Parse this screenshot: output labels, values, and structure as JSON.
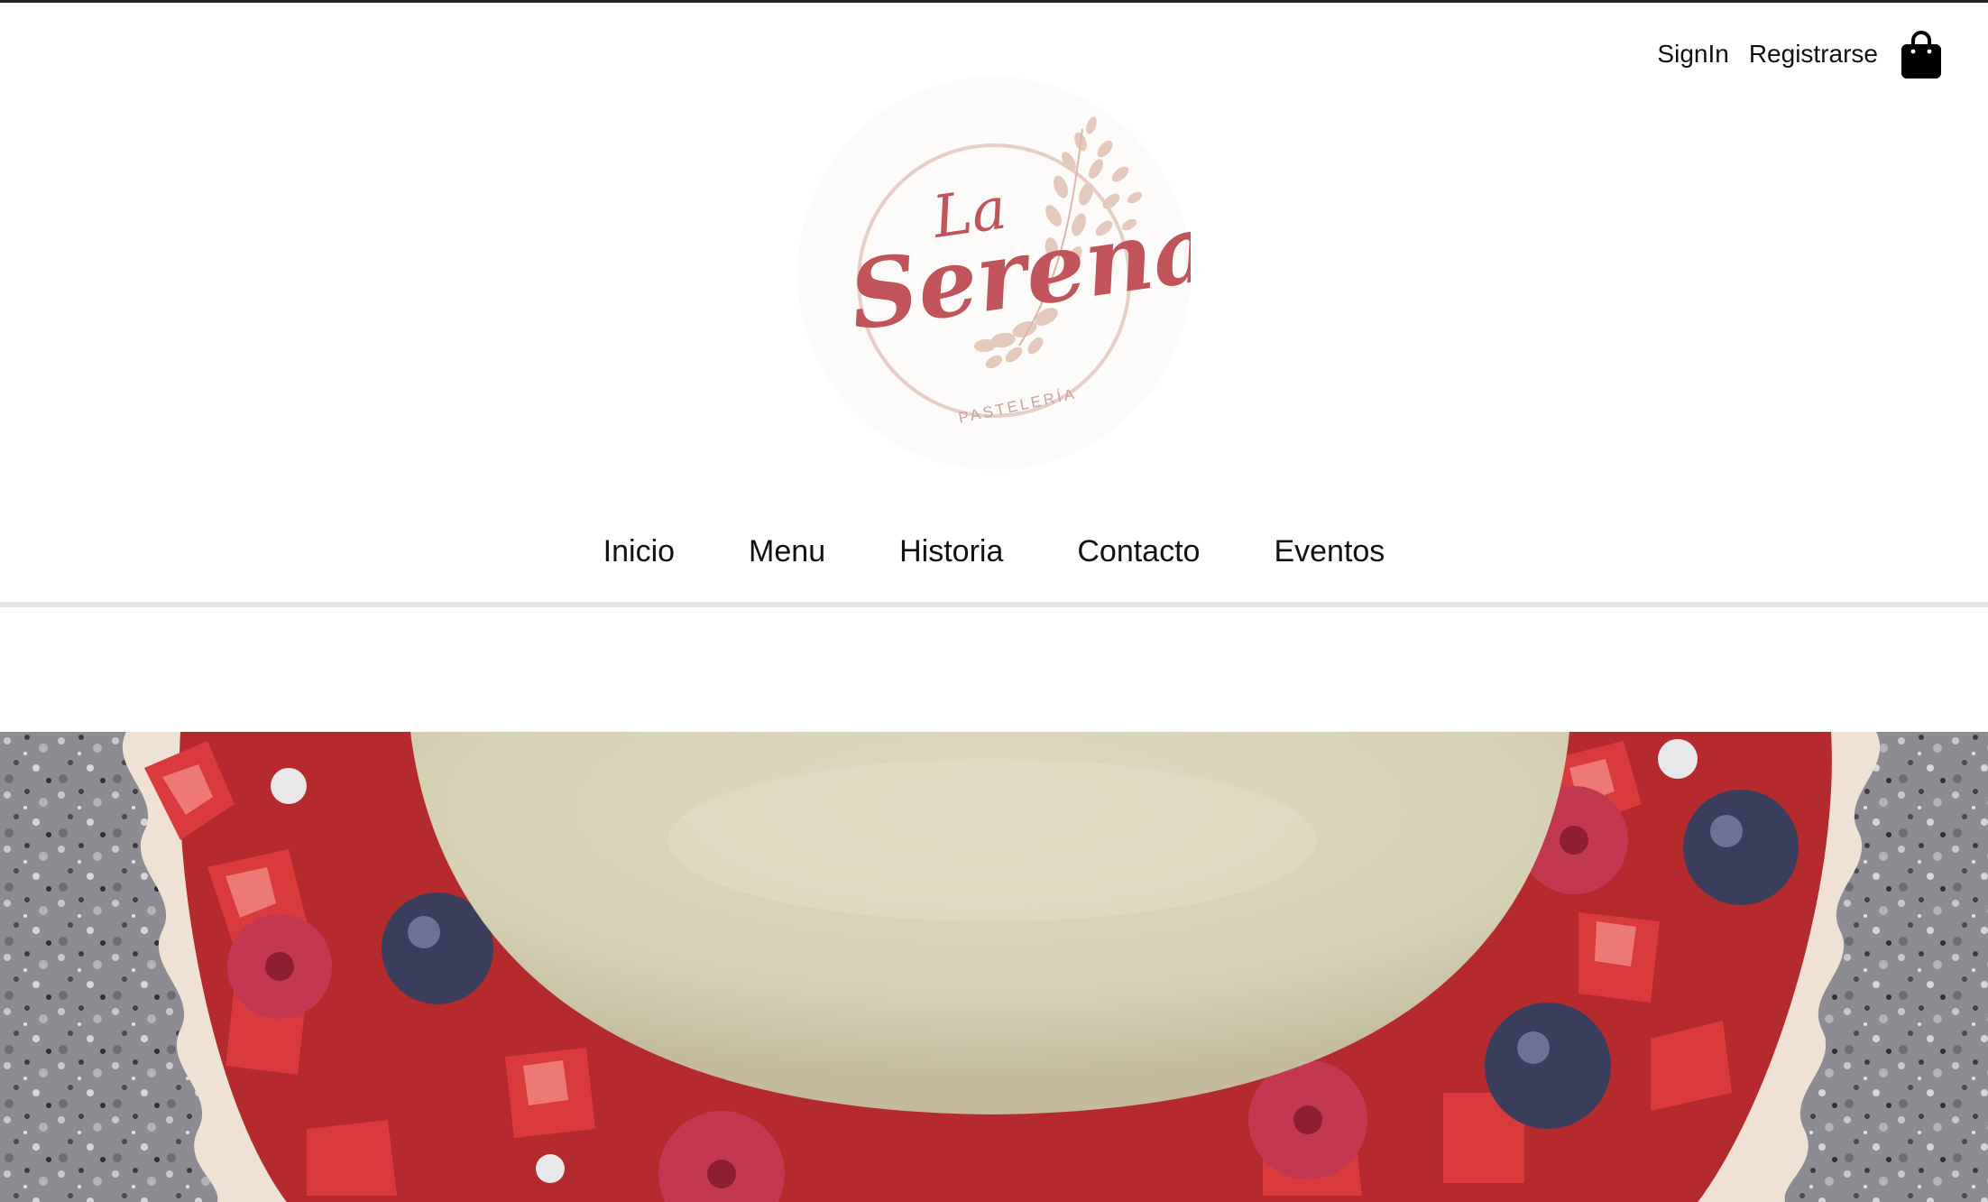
{
  "header": {
    "signin_label": "SignIn",
    "register_label": "Registrarse",
    "cart_icon": "shopping-bag-icon"
  },
  "logo": {
    "line1": "La",
    "line2": "Serena",
    "tagline": "PASTELERÍA"
  },
  "nav": {
    "items": [
      {
        "label": "Inicio"
      },
      {
        "label": "Menu"
      },
      {
        "label": "Historia"
      },
      {
        "label": "Contacto"
      },
      {
        "label": "Eventos"
      }
    ]
  },
  "colors": {
    "brand": "#c1535a",
    "logo_ring": "#e2c8bd",
    "divider": "#e6e4ec"
  }
}
